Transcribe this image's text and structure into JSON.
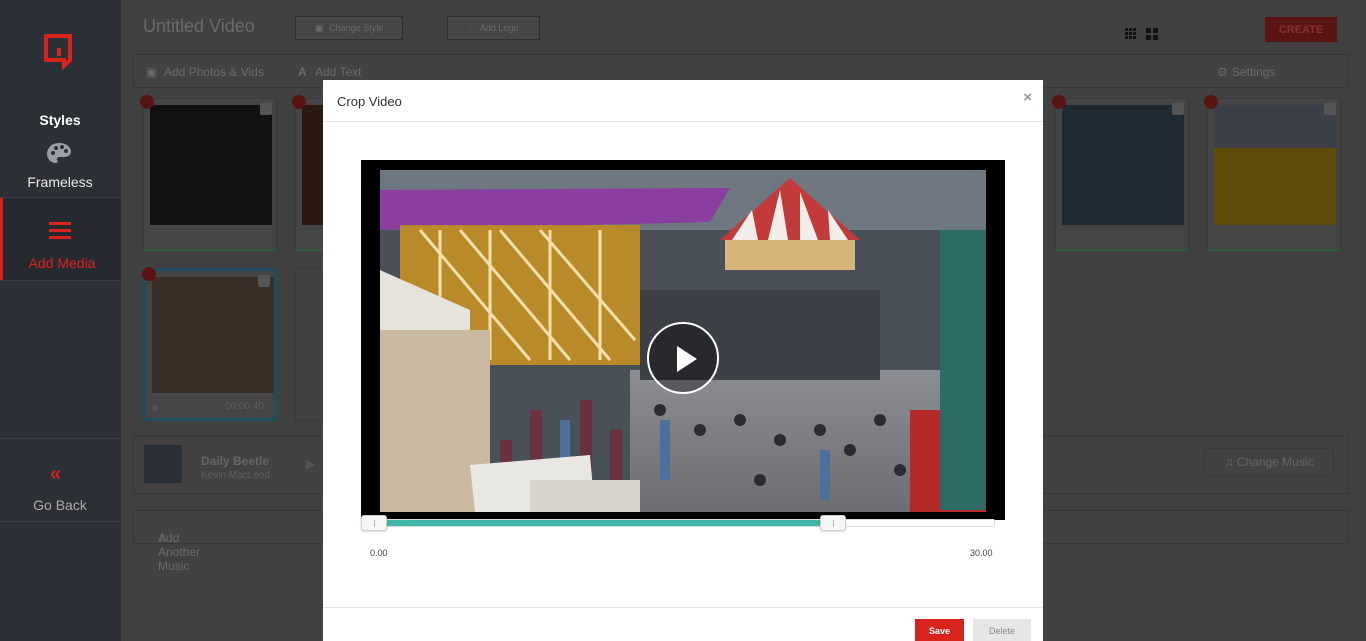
{
  "sidebar": {
    "styles_label": "Styles",
    "frameless_label": "Frameless",
    "add_media_label": "Add Media",
    "go_back_label": "Go Back",
    "go_back_icon": "«"
  },
  "editor": {
    "title": "Untitled Video",
    "change_style": "Change Style",
    "add_logo": "Add Logo",
    "create": "CREATE",
    "add_photos": "Add Photos & Vids",
    "add_text": "Add Text",
    "settings": "Settings",
    "selected_duration": "00:00:40",
    "music_title": "Daily Beetle",
    "music_artist": "Kevin MacLeod",
    "change_music": "Change Music",
    "add_another_music": "Add Another Music"
  },
  "modal": {
    "title": "Crop Video",
    "close": "×",
    "range_start_label": "0.00",
    "range_end_label": "30.00",
    "range_start_fraction": 0.0,
    "range_end_fraction": 0.74,
    "save": "Save",
    "delete": "Delete"
  },
  "colors": {
    "accent": "#d9231d",
    "slider": "#3fb6a6",
    "sidebar": "#2c3036"
  }
}
